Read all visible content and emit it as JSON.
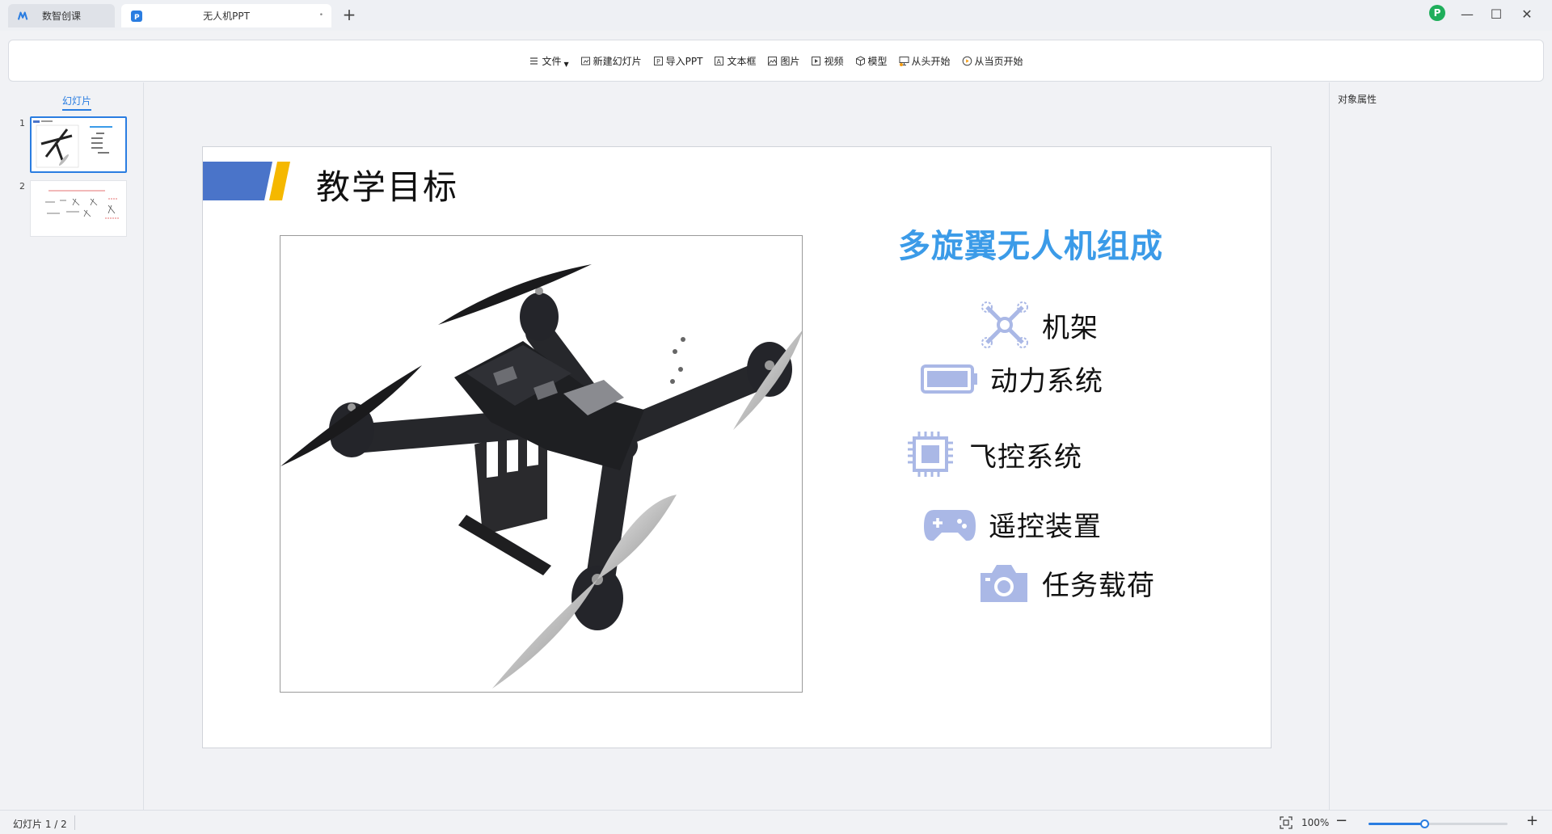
{
  "tabs": [
    {
      "label": "数智创课",
      "active": false
    },
    {
      "label": "无人机PPT",
      "active": true
    }
  ],
  "tabbar": {
    "new_tab": "+",
    "close_glyph": "•",
    "avatar_letter": "P"
  },
  "window_controls": {
    "minimize": "—",
    "maximize": "☐",
    "close": "✕"
  },
  "toolbar": {
    "file": "文件",
    "new_slide": "新建幻灯片",
    "import_ppt": "导入PPT",
    "text_box": "文本框",
    "image": "图片",
    "video": "视频",
    "model": "模型",
    "play_from_start": "从头开始",
    "play_from_current": "从当页开始"
  },
  "left_panel": {
    "title": "幻灯片",
    "slides": [
      {
        "number": "1",
        "active": true
      },
      {
        "number": "2",
        "active": false
      }
    ]
  },
  "right_panel": {
    "title": "对象属性"
  },
  "slide": {
    "title": "教学目标",
    "heading": "多旋翼无人机组成",
    "components": [
      {
        "label": "机架",
        "icon": "drone-frame-icon"
      },
      {
        "label": "动力系统",
        "icon": "battery-icon"
      },
      {
        "label": "飞控系统",
        "icon": "chip-icon"
      },
      {
        "label": "遥控装置",
        "icon": "gamepad-icon"
      },
      {
        "label": "任务载荷",
        "icon": "camera-icon"
      }
    ],
    "colors": {
      "accent_blue": "#4a74c9",
      "accent_yellow": "#f5b800",
      "heading_blue": "#3b9be8",
      "icon_fill": "#aab8e6"
    }
  },
  "statusbar": {
    "slide_indicator": "幻灯片 1 / 2",
    "zoom": "100%",
    "zoom_minus": "−",
    "zoom_plus": "+",
    "zoom_level": 0.4
  }
}
